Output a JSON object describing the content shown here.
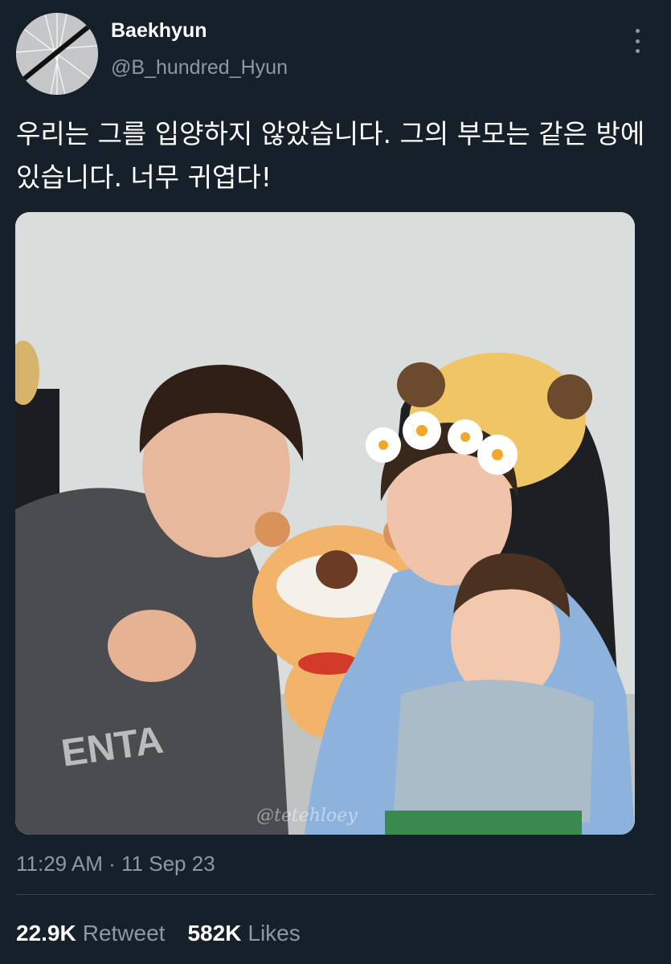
{
  "tweet": {
    "display_name": "Baekhyun",
    "handle": "@B_hundred_Hyun",
    "text": "우리는 그를 입양하지 않았습니다. 그의 부모는 같은 방에 있습니다. 너무 귀엽다!",
    "timestamp": "11:29 AM · 11 Sep 23",
    "media": {
      "watermark": "@tetehloey",
      "sweatshirt_text": "ENTA"
    },
    "stats": {
      "retweets_count": "22.9K",
      "retweets_label": "Retweet",
      "likes_count": "582K",
      "likes_label": "Likes"
    }
  },
  "icons": {
    "more": "more-vertical-icon"
  },
  "colors": {
    "background": "#15202b",
    "secondary_text": "#8b98a5",
    "divider": "#38444d"
  }
}
